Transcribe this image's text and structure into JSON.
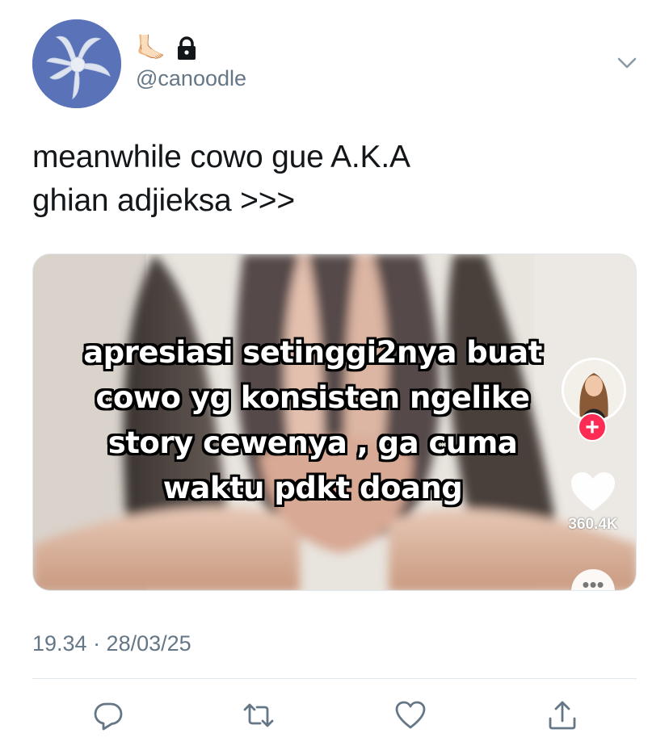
{
  "user": {
    "display_name": "🦶🏻",
    "handle": "@canoodle",
    "locked": true
  },
  "tweet": {
    "text_lines": [
      "meanwhile cowo gue A.K.A",
      "ghian adjieksa >>>"
    ],
    "timestamp": "19.34 · 28/03/25"
  },
  "media": {
    "caption_lines": [
      "apresiasi setinggi2nya buat",
      "cowo yg konsisten ngelike",
      "story cewenya , ga cuma",
      "waktu pdkt doang"
    ],
    "follow_symbol": "+",
    "like_count": "360.4K",
    "more_symbol": "•••"
  },
  "actions": {
    "reply": "reply-icon",
    "retweet": "retweet-icon",
    "like": "heart-icon",
    "share": "share-icon"
  },
  "colors": {
    "avatar_bg": "#5a72b8",
    "secondary_text": "#657786",
    "tiktok_red": "#fe2c55"
  }
}
